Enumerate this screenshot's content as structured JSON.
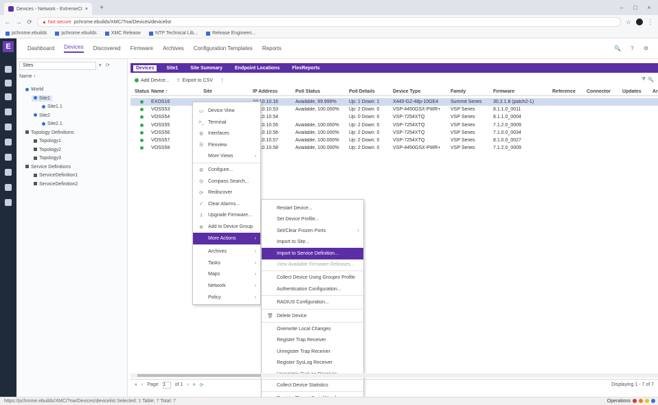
{
  "browser": {
    "tab_title": "Devices - Network - ExtremeCloud IQ",
    "new_tab": "+",
    "window_controls": [
      "–",
      "□",
      "×"
    ],
    "nav": [
      "←",
      "→",
      "⟳"
    ],
    "not_secure": "▲ Not secure",
    "url": "pchrome.ebuilds/XMC/?nw/Devices/devicelist",
    "bookmarks": [
      "pchrome.ebuilds",
      "pchrome.ebuilds",
      "XMC Release",
      "NTP Technical Lib...",
      "Release Engineeri..."
    ]
  },
  "app_nav": {
    "tabs": [
      "Dashboard",
      "Devices",
      "Discovered",
      "Firmware",
      "Archives",
      "Configuration Templates",
      "Reports"
    ],
    "active_tab": "Devices",
    "right_icons": "🔍 ? ⚙"
  },
  "rail": {
    "logo": "E"
  },
  "tree": {
    "site_selector": "Sites",
    "header": "Name ↑",
    "nodes": [
      {
        "label": "World",
        "type": "dot",
        "level": 0
      },
      {
        "label": "Site1",
        "type": "dot",
        "level": 1,
        "selected": true
      },
      {
        "label": "Site1.1",
        "type": "dot",
        "level": 2
      },
      {
        "label": "Site2",
        "type": "dot",
        "level": 1
      },
      {
        "label": "Site2.1",
        "type": "dot",
        "level": 2
      },
      {
        "label": "Topology Definitions",
        "type": "sq",
        "level": 0
      },
      {
        "label": "Topology1",
        "type": "sq",
        "level": 1
      },
      {
        "label": "Topology2",
        "type": "sq",
        "level": 1
      },
      {
        "label": "Topology3",
        "type": "sq",
        "level": 1
      },
      {
        "label": "Service Definitions",
        "type": "sq",
        "level": 0
      },
      {
        "label": "ServiceDefinition1",
        "type": "sq",
        "level": 1
      },
      {
        "label": "ServiceDefinition2",
        "type": "sq",
        "level": 1
      }
    ]
  },
  "sub_tabs": [
    "Devices",
    "Site1",
    "Site Summary",
    "Endpoint Locations",
    "FlexReports"
  ],
  "toolbar": {
    "add": "Add Device...",
    "export": "Export to CSV",
    "extra": "⋮"
  },
  "grid": {
    "columns": [
      "Status",
      "Name ↑",
      "Site",
      "IP Address",
      "Poll Status",
      "Poll Details",
      "Device Type",
      "Family",
      "Firmware",
      "Reference",
      "Connector",
      "Updates",
      "Arc"
    ],
    "rows": [
      {
        "name": "EXOS16",
        "ip": "10.10.10.16",
        "poll": "Available, 99.999%",
        "details": "Up: 1 Down: 1",
        "type": "X440-G2-48p-10GE4",
        "family": "Summit Series",
        "fw": "30.2.1.8 (patch2-1)"
      },
      {
        "name": "VOSS53",
        "ip": "10.10.10.53",
        "poll": "Available, 100.000%",
        "details": "Up: 2 Down: 0",
        "type": "VSP-4450GSX-PWR+",
        "family": "VSP Series",
        "fw": "8.1.1.0_0011"
      },
      {
        "name": "VOSS54",
        "ip": "10.10.10.54",
        "poll": "",
        "details": "Up: 0 Down: 0",
        "type": "VSP-7254XTQ",
        "family": "VSP Series",
        "fw": "8.1.1.0_0004"
      },
      {
        "name": "VOSS55",
        "ip": "10.10.10.55",
        "poll": "Available, 100.000%",
        "details": "Up: 2 Down: 0",
        "type": "VSP-7254XTQ",
        "family": "VSP Series",
        "fw": "7.1.2.0_0009"
      },
      {
        "name": "VOSS56",
        "ip": "10.10.10.56",
        "poll": "Available, 100.000%",
        "details": "Up: 2 Down: 0",
        "type": "VSP-7254XTQ",
        "family": "VSP Series",
        "fw": "7.1.0.0_0034"
      },
      {
        "name": "VOSS57",
        "ip": "10.10.10.57",
        "poll": "Available, 100.000%",
        "details": "Up: 2 Down: 0",
        "type": "VSP-7254XTQ",
        "family": "VSP Series",
        "fw": "8.1.0.0_0027"
      },
      {
        "name": "VOSS58",
        "ip": "10.10.10.58",
        "poll": "Available, 100.000%",
        "details": "Up: 2 Down: 0",
        "type": "VSP-4450GSX-PWR+",
        "family": "VSP Series",
        "fw": "7.1.2.0_0009"
      }
    ]
  },
  "context_menu": [
    {
      "label": "Device View",
      "icon": "▭"
    },
    {
      "label": "Terminal",
      "icon": ">_"
    },
    {
      "label": "Interfaces",
      "icon": "⚙"
    },
    {
      "label": "Flexview",
      "icon": "☰"
    },
    {
      "label": "More Views",
      "icon": "",
      "submenu": true
    },
    {
      "label": "Configure...",
      "icon": "⚙",
      "sep_before": true
    },
    {
      "label": "Compass Search...",
      "icon": "◎"
    },
    {
      "label": "Rediscover",
      "icon": "⟳"
    },
    {
      "label": "Clear Alarms...",
      "icon": "✓"
    },
    {
      "label": "Upgrade Firmware...",
      "icon": "⇩"
    },
    {
      "label": "Add to Device Group",
      "icon": "⊕"
    },
    {
      "label": "More Actions",
      "icon": "",
      "submenu": true,
      "active": true
    },
    {
      "label": "Archives",
      "icon": "",
      "submenu": true,
      "sep_before": true
    },
    {
      "label": "Tasks",
      "icon": "",
      "submenu": true
    },
    {
      "label": "Maps",
      "icon": "",
      "submenu": true
    },
    {
      "label": "Network",
      "icon": "",
      "submenu": true
    },
    {
      "label": "Policy",
      "icon": "",
      "submenu": true
    }
  ],
  "more_actions_menu": [
    {
      "label": "Restart Device..."
    },
    {
      "label": "Set Device Profile..."
    },
    {
      "label": "Set/Clear Frozen Ports",
      "submenu": true
    },
    {
      "label": "Import to Site..."
    },
    {
      "label": "Import to Service Definition...",
      "active": true
    },
    {
      "label": "View Available Firmware Releases...",
      "disabled": true
    },
    {
      "label": "Collect Device Using Groupro Profile",
      "sep_before": true
    },
    {
      "label": "Authentication Configuration..."
    },
    {
      "label": "RADIUS Configuration...",
      "sep_before": true
    },
    {
      "label": "Delete Device",
      "icon": "🗑",
      "sep_before": true
    },
    {
      "label": "Overwrite Local Changes",
      "sep_before": true
    },
    {
      "label": "Register Trap Receiver"
    },
    {
      "label": "Unregister Trap Receiver"
    },
    {
      "label": "Register SysLog Receiver"
    },
    {
      "label": "Unregister SysLog Receiver"
    },
    {
      "label": "Collect Device Statistics"
    },
    {
      "label": "Register/Export Serial Numbers...",
      "sep_before": true
    }
  ],
  "pager": {
    "page_label": "Page",
    "page_value": "1",
    "of": "of 1",
    "displaying": "Displaying 1 - 7 of 7"
  },
  "statusbar": {
    "left": "https://pchrome.ebuilds/XMC/?nw/Devices/devicelist    Selected: 1  Table: 7 Total: 7",
    "right": "Operations"
  }
}
